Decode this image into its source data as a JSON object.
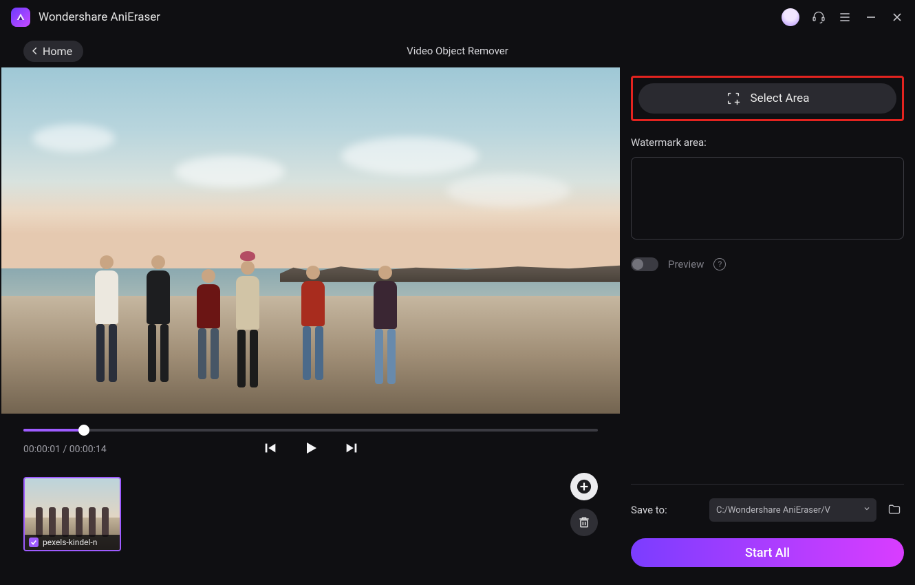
{
  "app": {
    "name": "Wondershare AniEraser"
  },
  "header": {
    "home_label": "Home",
    "page_title": "Video Object Remover"
  },
  "player": {
    "current_time": "00:00:01",
    "duration": "00:00:14",
    "time_display": "00:00:01 / 00:00:14",
    "progress_percent": 10.5
  },
  "clip": {
    "filename": "pexels-kindel-n",
    "selected": true
  },
  "sidebar": {
    "select_area_label": "Select Area",
    "watermark_label": "Watermark area:",
    "preview_label": "Preview",
    "preview_enabled": false
  },
  "save": {
    "label": "Save to:",
    "path": "C:/Wondershare AniEraser/V"
  },
  "actions": {
    "start_all": "Start All"
  },
  "colors": {
    "accent": "#9e5cff",
    "highlight_border": "#e3231f"
  }
}
